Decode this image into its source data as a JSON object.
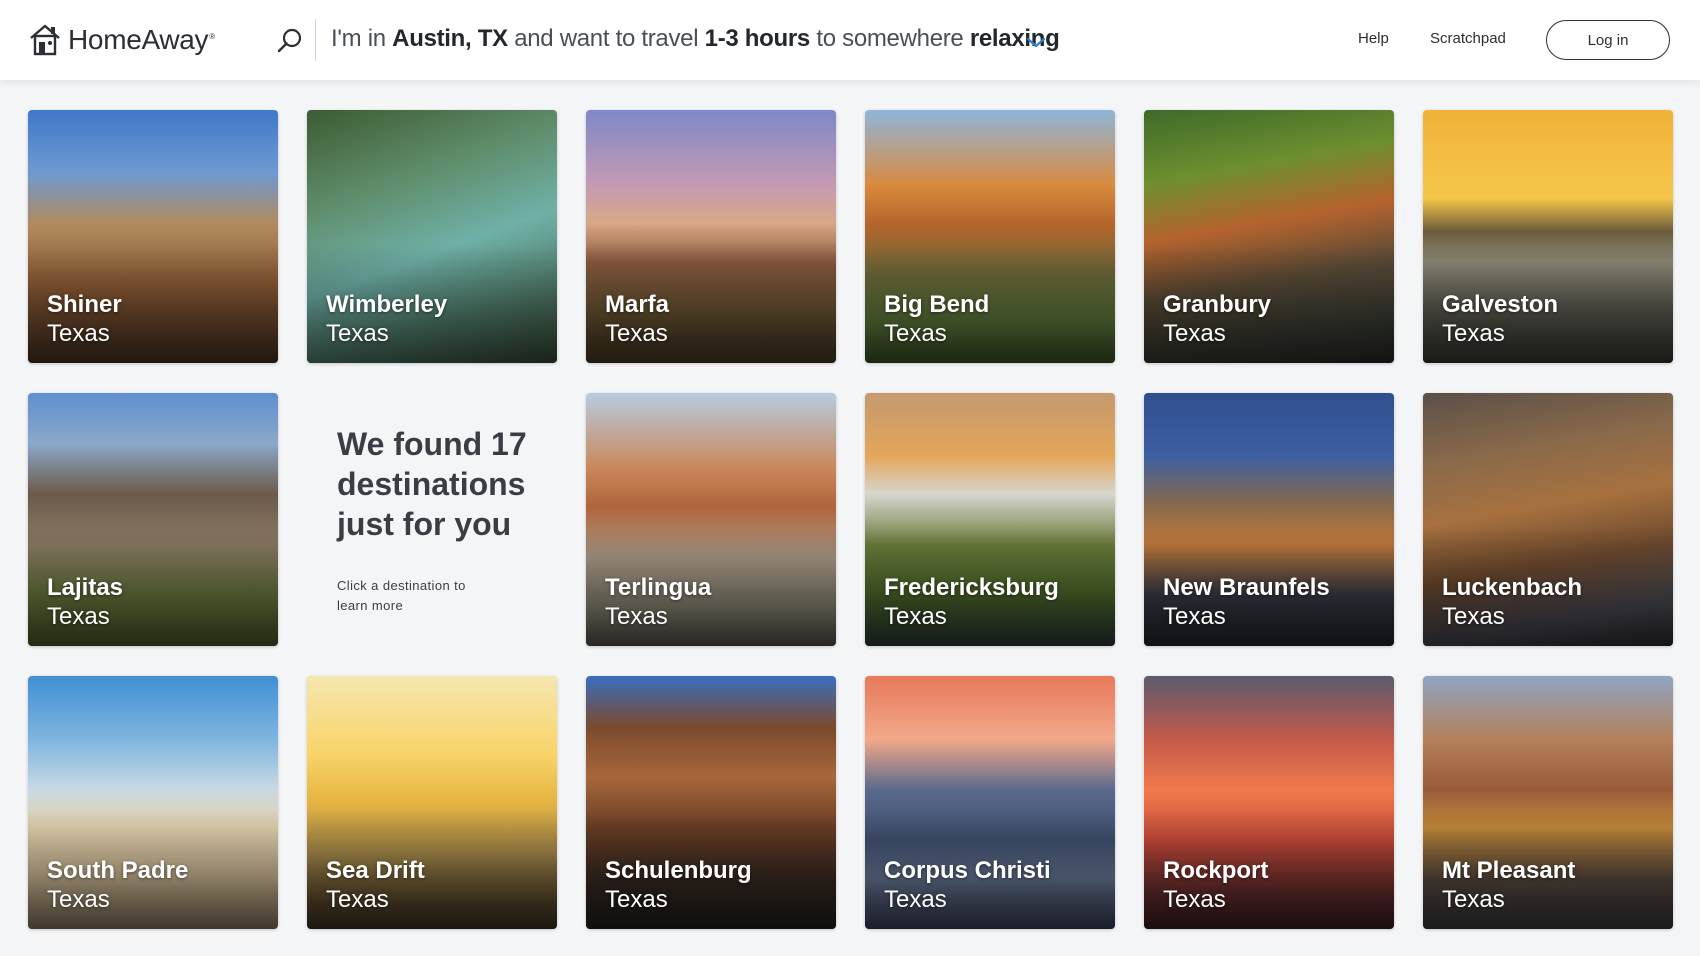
{
  "brand": {
    "name": "HomeAway",
    "reg": "®"
  },
  "search": {
    "prefix": "I'm in ",
    "location": "Austin, TX",
    "middle": " and want to travel ",
    "duration": "1-3 hours",
    "tail": " to somewhere ",
    "mood": "relaxing"
  },
  "nav": {
    "help": "Help",
    "scratchpad": "Scratchpad",
    "login": "Log in"
  },
  "results": {
    "title": "We found 17 destinations just for you",
    "subtitle": "Click a destination to learn more"
  },
  "destinations": [
    {
      "name": "Shiner",
      "state": "Texas"
    },
    {
      "name": "Wimberley",
      "state": "Texas"
    },
    {
      "name": "Marfa",
      "state": "Texas"
    },
    {
      "name": "Big Bend",
      "state": "Texas"
    },
    {
      "name": "Granbury",
      "state": "Texas"
    },
    {
      "name": "Galveston",
      "state": "Texas"
    },
    {
      "name": "Lajitas",
      "state": "Texas"
    },
    {
      "name": "Terlingua",
      "state": "Texas"
    },
    {
      "name": "Fredericksburg",
      "state": "Texas"
    },
    {
      "name": "New Braunfels",
      "state": "Texas"
    },
    {
      "name": "Luckenbach",
      "state": "Texas"
    },
    {
      "name": "South Padre",
      "state": "Texas"
    },
    {
      "name": "Sea Drift",
      "state": "Texas"
    },
    {
      "name": "Schulenburg",
      "state": "Texas"
    },
    {
      "name": "Corpus Christi",
      "state": "Texas"
    },
    {
      "name": "Rockport",
      "state": "Texas"
    },
    {
      "name": "Mt Pleasant",
      "state": "Texas"
    }
  ],
  "colors": {
    "accent": "#2a7fd4",
    "text": "#2b2e33",
    "background": "#f4f5f7"
  }
}
